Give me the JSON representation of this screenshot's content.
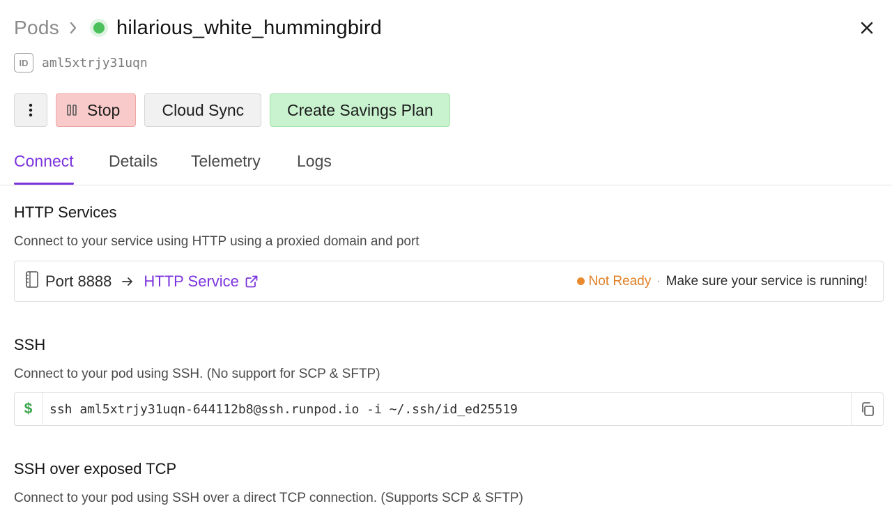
{
  "header": {
    "breadcrumb_root": "Pods",
    "pod_name": "hilarious_white_hummingbird",
    "status_color": "#4cc15b"
  },
  "pod_id": {
    "badge": "ID",
    "value": "aml5xtrjy31uqn"
  },
  "toolbar": {
    "more_icon": "vertical-dots-icon",
    "stop_label": "Stop",
    "cloud_sync_label": "Cloud Sync",
    "savings_label": "Create Savings Plan"
  },
  "tabs": [
    {
      "label": "Connect",
      "active": true
    },
    {
      "label": "Details",
      "active": false
    },
    {
      "label": "Telemetry",
      "active": false
    },
    {
      "label": "Logs",
      "active": false
    }
  ],
  "http_services": {
    "title": "HTTP Services",
    "description": "Connect to your service using HTTP using a proxied domain and port",
    "port_label": "Port 8888",
    "service_label": "HTTP Service",
    "status": "Not Ready",
    "status_color": "#e07f25",
    "hint": "Make sure your service is running!"
  },
  "ssh": {
    "title": "SSH",
    "description": "Connect to your pod using SSH. (No support for SCP & SFTP)",
    "prompt": "$",
    "command": "ssh aml5xtrjy31uqn-644112b8@ssh.runpod.io -i ~/.ssh/id_ed25519"
  },
  "ssh_tcp": {
    "title": "SSH over exposed TCP",
    "description": "Connect to your pod using SSH over a direct TCP connection. (Supports SCP & SFTP)"
  },
  "colors": {
    "accent": "#7b34dc",
    "stop_bg": "#f8caca",
    "savings_bg": "#c9f2cf"
  }
}
